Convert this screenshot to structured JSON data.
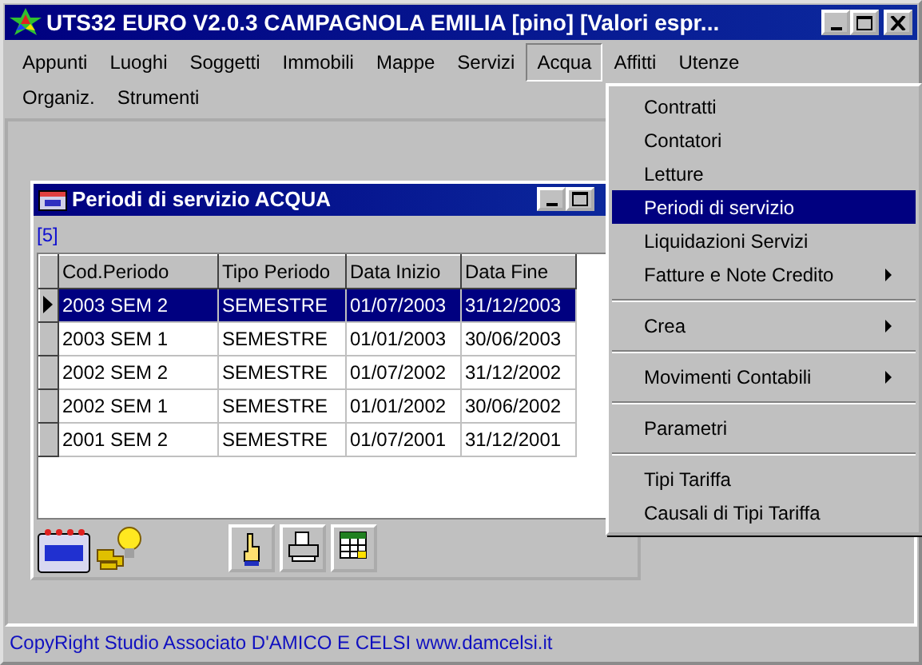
{
  "window": {
    "title": "UTS32 EURO V2.0.3 CAMPAGNOLA EMILIA [pino]  [Valori espr...",
    "buttons": [
      {
        "kind": "minimize"
      },
      {
        "kind": "maximize"
      },
      {
        "kind": "close"
      }
    ]
  },
  "menu_bar": {
    "rows": [
      [
        {
          "label": "Appunti",
          "selected": false
        },
        {
          "label": "Luoghi",
          "selected": false
        },
        {
          "label": "Soggetti",
          "selected": false
        },
        {
          "label": "Immobili",
          "selected": false
        },
        {
          "label": "Mappe",
          "selected": false
        },
        {
          "label": "Servizi",
          "selected": false
        },
        {
          "label": "Acqua",
          "selected": true
        },
        {
          "label": "Affitti",
          "selected": false
        },
        {
          "label": "Utenze",
          "selected": false
        }
      ],
      [
        {
          "label": "Organiz.",
          "selected": false
        },
        {
          "label": "Strumenti",
          "selected": false
        }
      ]
    ]
  },
  "dropdown": {
    "items": [
      {
        "kind": "item",
        "label": "Contratti",
        "selected": false,
        "submenu": false
      },
      {
        "kind": "item",
        "label": "Contatori",
        "selected": false,
        "submenu": false
      },
      {
        "kind": "item",
        "label": "Letture",
        "selected": false,
        "submenu": false
      },
      {
        "kind": "item",
        "label": "Periodi di servizio",
        "selected": true,
        "submenu": false
      },
      {
        "kind": "item",
        "label": "Liquidazioni Servizi",
        "selected": false,
        "submenu": false
      },
      {
        "kind": "item",
        "label": "Fatture e Note Credito",
        "selected": false,
        "submenu": true
      },
      {
        "kind": "separator"
      },
      {
        "kind": "item",
        "label": "Crea",
        "selected": false,
        "submenu": true
      },
      {
        "kind": "separator"
      },
      {
        "kind": "item",
        "label": "Movimenti Contabili",
        "selected": false,
        "submenu": true
      },
      {
        "kind": "separator"
      },
      {
        "kind": "item",
        "label": "Parametri",
        "selected": false,
        "submenu": false
      },
      {
        "kind": "separator"
      },
      {
        "kind": "item",
        "label": "Tipi Tariffa",
        "selected": false,
        "submenu": false
      },
      {
        "kind": "item",
        "label": "Causali di Tipi Tariffa",
        "selected": false,
        "submenu": false
      }
    ]
  },
  "child_window": {
    "title": "Periodi di servizio ACQUA",
    "buttons": [
      {
        "kind": "minimize"
      },
      {
        "kind": "maximize"
      }
    ],
    "count": "[5]",
    "table": {
      "columns": [
        "Cod.Periodo",
        "Tipo Periodo",
        "Data Inizio",
        "Data Fine"
      ],
      "rows": [
        {
          "cells": [
            "2003 SEM 2",
            "SEMESTRE",
            "01/07/2003",
            "31/12/2003"
          ],
          "selected": true
        },
        {
          "cells": [
            "2003 SEM 1",
            "SEMESTRE",
            "01/01/2003",
            "30/06/2003"
          ],
          "selected": false
        },
        {
          "cells": [
            "2002 SEM 2",
            "SEMESTRE",
            "01/07/2002",
            "31/12/2002"
          ],
          "selected": false
        },
        {
          "cells": [
            "2002 SEM 1",
            "SEMESTRE",
            "01/01/2002",
            "30/06/2002"
          ],
          "selected": false
        },
        {
          "cells": [
            "2001 SEM 2",
            "SEMESTRE",
            "01/07/2001",
            "31/12/2001"
          ],
          "selected": false
        }
      ]
    },
    "toolbar": [
      {
        "kind": "calendar"
      },
      {
        "kind": "tap"
      },
      {
        "kind": "hand"
      },
      {
        "kind": "printer"
      },
      {
        "kind": "grid"
      }
    ]
  },
  "status_bar": "CopyRight Studio Associato D'AMICO E CELSI  www.damcelsi.it"
}
